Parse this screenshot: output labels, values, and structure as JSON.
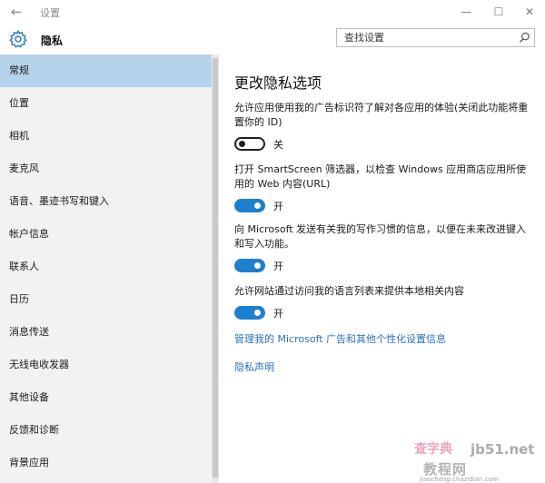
{
  "window": {
    "title": "设置",
    "back_glyph": "←",
    "minimize_glyph": "—",
    "maximize_glyph": "☐",
    "close_glyph": "✕"
  },
  "header": {
    "title": "隐私",
    "search_placeholder": "查找设置"
  },
  "sidebar": {
    "items": [
      {
        "label": "常规",
        "active": true
      },
      {
        "label": "位置"
      },
      {
        "label": "相机"
      },
      {
        "label": "麦克风"
      },
      {
        "label": "语音、墨迹书写和键入"
      },
      {
        "label": "帐户信息"
      },
      {
        "label": "联系人"
      },
      {
        "label": "日历"
      },
      {
        "label": "消息传送"
      },
      {
        "label": "无线电收发器"
      },
      {
        "label": "其他设备"
      },
      {
        "label": "反馈和诊断"
      },
      {
        "label": "背景应用"
      }
    ]
  },
  "main": {
    "title": "更改隐私选项",
    "settings": [
      {
        "description": "允许应用使用我的广告标识符了解对各应用的体验(关闭此功能将重置你的 ID)",
        "state": "off",
        "state_label": "关"
      },
      {
        "description": "打开 SmartScreen 筛选器，以检查 Windows 应用商店应用所使用的 Web 内容(URL)",
        "state": "on",
        "state_label": "开"
      },
      {
        "description": "向 Microsoft 发送有关我的写作习惯的信息，以便在未来改进键入和写入功能。",
        "state": "on",
        "state_label": "开"
      },
      {
        "description": "允许网站通过访问我的语言列表来提供本地相关内容",
        "state": "on",
        "state_label": "开"
      }
    ],
    "links": {
      "manage_ads": "管理我的 Microsoft 广告和其他个性化设置信息",
      "privacy_statement": "隐私声明"
    }
  },
  "watermark": {
    "text_a": "查字典",
    "text_b": "jb51.net",
    "text_c": "教程网",
    "text_d": "jiaocheng.chazidian.com"
  },
  "colors": {
    "accent": "#1f7fcf",
    "link": "#2a6fb8",
    "sidebar_bg": "#f2f2f2",
    "sidebar_active": "#b6d3ec"
  }
}
